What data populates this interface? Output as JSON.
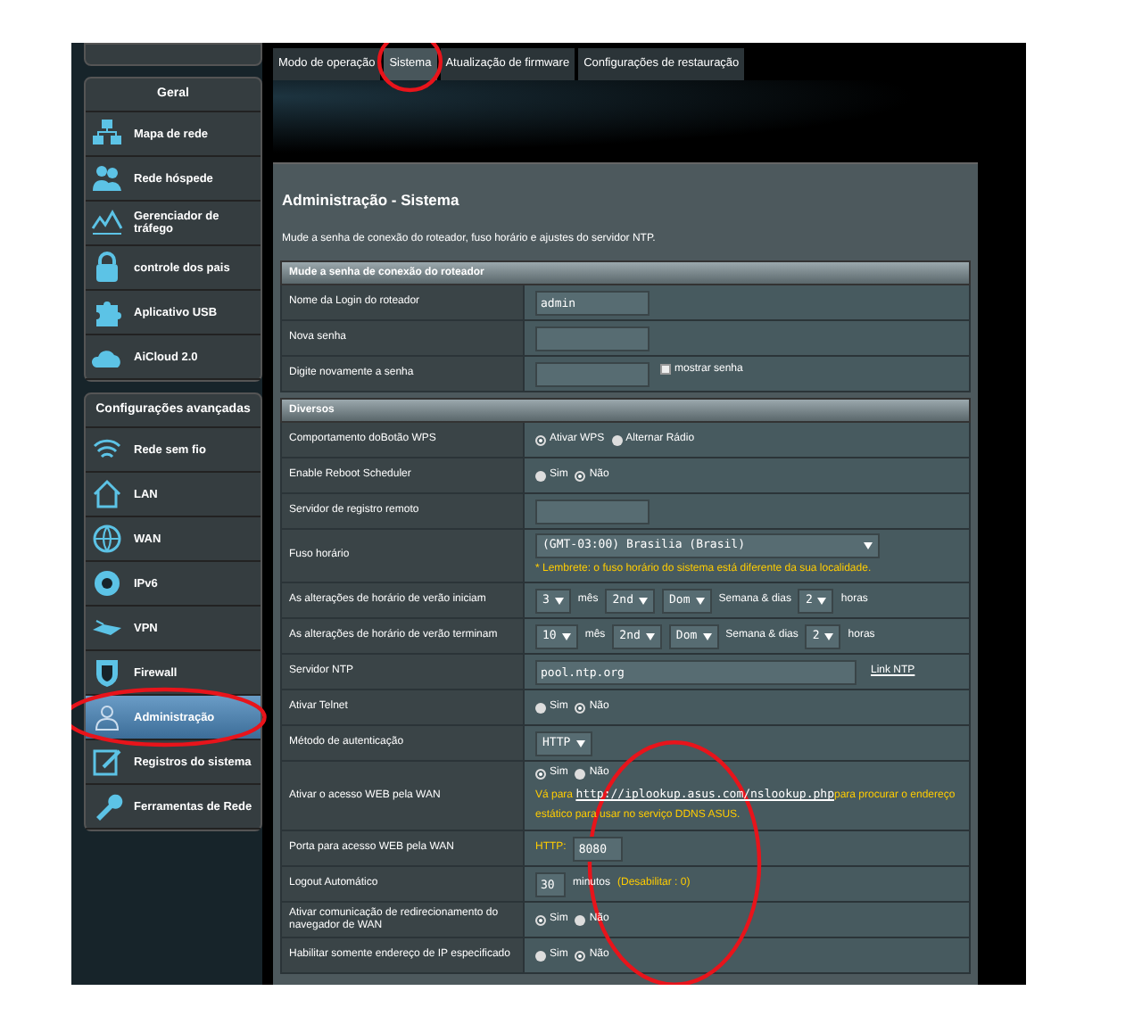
{
  "tabs": [
    {
      "label": "Modo de operação",
      "selected": false,
      "circled": false
    },
    {
      "label": "Sistema",
      "selected": true,
      "circled": true
    },
    {
      "label": "Atualização de firmware",
      "selected": false,
      "circled": false
    },
    {
      "label": "Configurações de restauração",
      "selected": false,
      "circled": false
    }
  ],
  "sidebar": [
    {
      "title": "Geral",
      "items": [
        {
          "label": "Mapa de rede",
          "selected": false,
          "circled": false
        },
        {
          "label": "Rede hóspede",
          "selected": false,
          "circled": false
        },
        {
          "label": "Gerenciador de tráfego",
          "selected": false,
          "circled": false
        },
        {
          "label": "controle dos pais",
          "selected": false,
          "circled": false
        },
        {
          "label": "Aplicativo USB",
          "selected": false,
          "circled": false
        },
        {
          "label": "AiCloud 2.0",
          "selected": false,
          "circled": false
        }
      ]
    },
    {
      "title": "Configurações avançadas",
      "items": [
        {
          "label": "Rede sem fio",
          "selected": false,
          "circled": false
        },
        {
          "label": "LAN",
          "selected": false,
          "circled": false
        },
        {
          "label": "WAN",
          "selected": false,
          "circled": false
        },
        {
          "label": "IPv6",
          "selected": false,
          "circled": false
        },
        {
          "label": "VPN",
          "selected": false,
          "circled": false
        },
        {
          "label": "Firewall",
          "selected": false,
          "circled": false
        },
        {
          "label": "Administração",
          "selected": true,
          "circled": true
        },
        {
          "label": "Registros do sistema",
          "selected": false,
          "circled": false
        },
        {
          "label": "Ferramentas de Rede",
          "selected": false,
          "circled": false
        }
      ]
    }
  ],
  "panel": {
    "title": "Administração - Sistema",
    "description": "Mude a senha de conexão do roteador, fuso horário e ajustes do servidor NTP.",
    "sections": [
      {
        "title": "Mude a senha de conexão do roteador",
        "rows": [
          {
            "label": "Nome da Login do roteador",
            "circled": false,
            "lines": [
              [
                {
                  "kind": "input",
                  "value": "admin"
                }
              ]
            ]
          },
          {
            "label": "Nova senha",
            "circled": false,
            "lines": [
              [
                {
                  "kind": "input"
                }
              ]
            ]
          },
          {
            "label": "Digite novamente a senha",
            "circled": false,
            "lines": [
              [
                {
                  "kind": "input"
                },
                {
                  "kind": "checkbox",
                  "label": "mostrar senha",
                  "checked": false
                }
              ]
            ]
          }
        ]
      },
      {
        "title": "Diversos",
        "rows": [
          {
            "label": "Comportamento doBotão WPS",
            "circled": false,
            "lines": [
              [
                {
                  "kind": "radio",
                  "label": "Ativar WPS",
                  "selected": true
                },
                {
                  "kind": "radio",
                  "label": "Alternar Rádio",
                  "selected": false
                }
              ]
            ]
          },
          {
            "label": "Enable Reboot Scheduler",
            "circled": false,
            "lines": [
              [
                {
                  "kind": "radio",
                  "label": "Sim",
                  "selected": false
                },
                {
                  "kind": "radio",
                  "label": "Não",
                  "selected": true
                }
              ]
            ]
          },
          {
            "label": "Servidor de registro remoto",
            "circled": false,
            "lines": [
              [
                {
                  "kind": "input"
                }
              ]
            ]
          },
          {
            "label": "Fuso horário",
            "circled": false,
            "lines": [
              [
                {
                  "kind": "select_wide",
                  "value": "(GMT-03:00) Brasilia (Brasil)"
                }
              ],
              [
                {
                  "kind": "note",
                  "text": "* Lembrete: o fuso horário do sistema está diferente da sua localidade."
                }
              ]
            ]
          },
          {
            "label": "As alterações de horário de verão iniciam",
            "circled": false,
            "lines": [
              [
                {
                  "kind": "select",
                  "value": "3"
                },
                {
                  "kind": "text",
                  "text": "mês"
                },
                {
                  "kind": "select",
                  "value": "2nd"
                },
                {
                  "kind": "select",
                  "value": "Dom"
                },
                {
                  "kind": "text",
                  "text": "Semana & dias"
                },
                {
                  "kind": "select",
                  "value": "2"
                },
                {
                  "kind": "text",
                  "text": "horas"
                }
              ]
            ]
          },
          {
            "label": "As alterações de horário de verão terminam",
            "circled": false,
            "lines": [
              [
                {
                  "kind": "select",
                  "value": "10"
                },
                {
                  "kind": "text",
                  "text": "mês"
                },
                {
                  "kind": "select",
                  "value": "2nd"
                },
                {
                  "kind": "select",
                  "value": "Dom"
                },
                {
                  "kind": "text",
                  "text": "Semana & dias"
                },
                {
                  "kind": "select",
                  "value": "2"
                },
                {
                  "kind": "text",
                  "text": "horas"
                }
              ]
            ]
          },
          {
            "label": "Servidor NTP",
            "circled": false,
            "lines": [
              [
                {
                  "kind": "input_wide",
                  "value": "pool.ntp.org"
                },
                {
                  "kind": "link",
                  "text": "Link NTP"
                }
              ]
            ]
          },
          {
            "label": "Ativar Telnet",
            "circled": false,
            "lines": [
              [
                {
                  "kind": "radio",
                  "label": "Sim",
                  "selected": false
                },
                {
                  "kind": "radio",
                  "label": "Não",
                  "selected": true
                }
              ]
            ]
          },
          {
            "label": "Método de autenticação",
            "circled": false,
            "lines": [
              [
                {
                  "kind": "select",
                  "value": "HTTP"
                }
              ]
            ]
          },
          {
            "label": "Ativar o acesso WEB pela WAN",
            "circled": false,
            "lines": [
              [
                {
                  "kind": "radio",
                  "label": "Sim",
                  "selected": true
                },
                {
                  "kind": "radio",
                  "label": "Não",
                  "selected": false
                }
              ],
              [
                {
                  "kind": "note_link",
                  "before": "Vá para ",
                  "link": "http://iplookup.asus.com/nslookup.php",
                  "after": "para procurar o endereço estático para usar no serviço DDNS ASUS."
                }
              ]
            ]
          },
          {
            "label": "Porta para acesso WEB pela WAN",
            "circled": true,
            "lines": [
              [
                {
                  "kind": "note",
                  "text": "HTTP:"
                },
                {
                  "kind": "input_small",
                  "value": "8080"
                }
              ]
            ]
          },
          {
            "label": "Logout Automático",
            "circled": false,
            "lines": [
              [
                {
                  "kind": "input_tiny",
                  "value": "30"
                },
                {
                  "kind": "text",
                  "text": "minutos"
                },
                {
                  "kind": "note",
                  "text": "(Desabilitar : 0)"
                }
              ]
            ]
          },
          {
            "label": "Ativar comunicação de redirecionamento do navegador de WAN",
            "circled": false,
            "lines": [
              [
                {
                  "kind": "radio",
                  "label": "Sim",
                  "selected": true
                },
                {
                  "kind": "radio",
                  "label": "Não",
                  "selected": false
                }
              ]
            ]
          },
          {
            "label": "Habilitar somente endereço de IP especificado",
            "circled": false,
            "lines": [
              [
                {
                  "kind": "radio",
                  "label": "Sim",
                  "selected": false
                },
                {
                  "kind": "radio",
                  "label": "Não",
                  "selected": true
                }
              ]
            ]
          }
        ]
      }
    ]
  }
}
